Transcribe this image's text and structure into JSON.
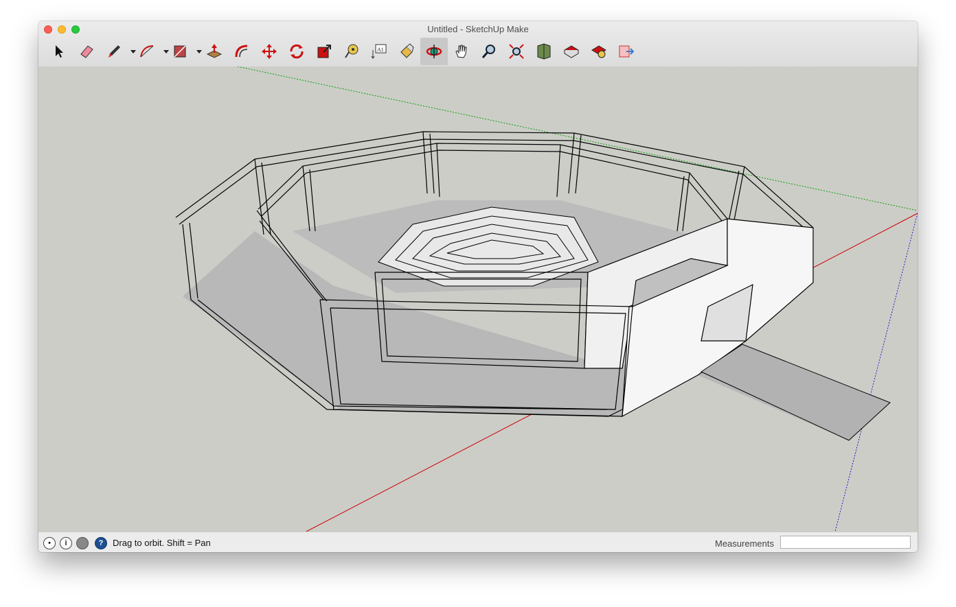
{
  "window": {
    "title": "Untitled - SketchUp Make"
  },
  "toolbar": {
    "tools": [
      {
        "name": "select-tool",
        "icon": "arrow-cursor-icon"
      },
      {
        "name": "eraser-tool",
        "icon": "eraser-icon"
      },
      {
        "name": "line-tool",
        "icon": "pencil-icon",
        "dropdown": true
      },
      {
        "name": "arc-tool",
        "icon": "arc-icon",
        "dropdown": true
      },
      {
        "name": "rectangle-tool",
        "icon": "rectangle-icon",
        "dropdown": true
      },
      {
        "name": "push-pull-tool",
        "icon": "push-pull-icon"
      },
      {
        "name": "offset-tool",
        "icon": "offset-icon"
      },
      {
        "name": "move-tool",
        "icon": "move-icon"
      },
      {
        "name": "rotate-tool",
        "icon": "rotate-icon"
      },
      {
        "name": "scale-tool",
        "icon": "scale-icon"
      },
      {
        "name": "tape-measure-tool",
        "icon": "tape-measure-icon"
      },
      {
        "name": "text-tool",
        "icon": "text-icon",
        "label": "A1"
      },
      {
        "name": "paint-bucket-tool",
        "icon": "paint-bucket-icon"
      },
      {
        "name": "orbit-tool",
        "icon": "orbit-icon",
        "active": true
      },
      {
        "name": "pan-tool",
        "icon": "hand-icon"
      },
      {
        "name": "zoom-tool",
        "icon": "magnifier-icon"
      },
      {
        "name": "zoom-extents-tool",
        "icon": "zoom-extents-icon"
      },
      {
        "name": "3d-warehouse-button",
        "icon": "warehouse-icon"
      },
      {
        "name": "extension-warehouse-button",
        "icon": "extension-icon"
      },
      {
        "name": "share-component-button",
        "icon": "share-component-icon"
      },
      {
        "name": "send-to-layout-button",
        "icon": "layout-icon"
      }
    ]
  },
  "statusbar": {
    "hint": "Drag to orbit.  Shift = Pan",
    "measurements_label": "Measurements",
    "measurements_value": ""
  },
  "colors": {
    "viewport_bg": "#cdcdc8",
    "axis_red": "#cc0000",
    "axis_green": "#00a000",
    "axis_blue": "#2020c0",
    "model_face": "#f2f2f2",
    "model_shadow": "#b8b8b8",
    "edge": "#000000"
  }
}
